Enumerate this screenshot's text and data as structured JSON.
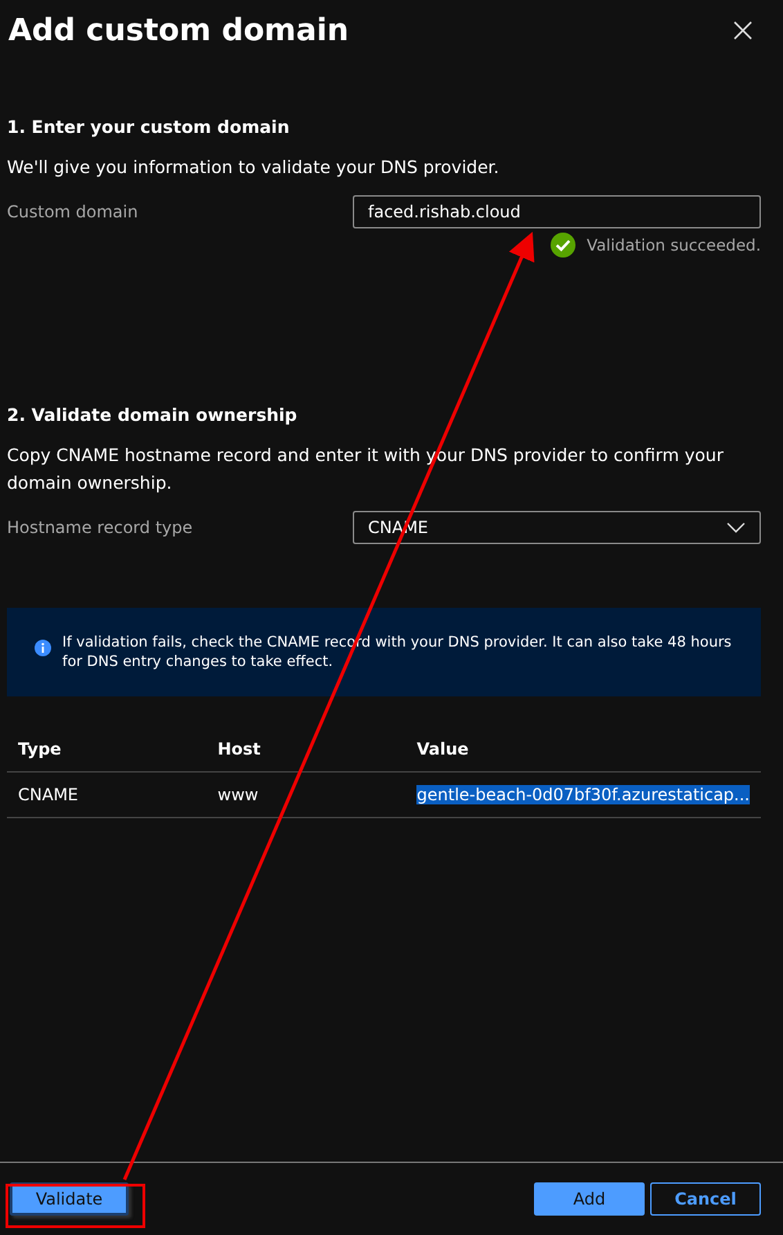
{
  "panel": {
    "title": "Add custom domain"
  },
  "section_1": {
    "heading": "1. Enter your custom domain",
    "description": "We'll give you information to validate your DNS provider.",
    "field": {
      "label": "Custom domain",
      "value": "faced.rishab.cloud"
    },
    "validation": {
      "succeeded": true,
      "message": "Validation succeeded."
    }
  },
  "section_2": {
    "heading": "2. Validate domain ownership",
    "description": "Copy CNAME hostname record and enter it with your DNS provider to confirm your domain ownership.",
    "dropdown": {
      "label": "Hostname record type",
      "value": "CNAME"
    },
    "info": "If validation fails, check the CNAME record with your DNS provider. It can also take 48 hours for DNS entry changes to take effect."
  },
  "table": {
    "columns": [
      "Type",
      "Host",
      "Value"
    ],
    "rows": [
      {
        "cells": [
          "CNAME",
          "www",
          "gentle-beach-0d07bf30f.azurestaticap..."
        ],
        "value_highlighted": true
      }
    ]
  },
  "footer": {
    "buttons": [
      {
        "label": "Validate",
        "kind": "secondary-filled",
        "annotated": true
      },
      {
        "label": "Add",
        "kind": "primary"
      },
      {
        "label": "Cancel",
        "kind": "outline"
      }
    ]
  }
}
